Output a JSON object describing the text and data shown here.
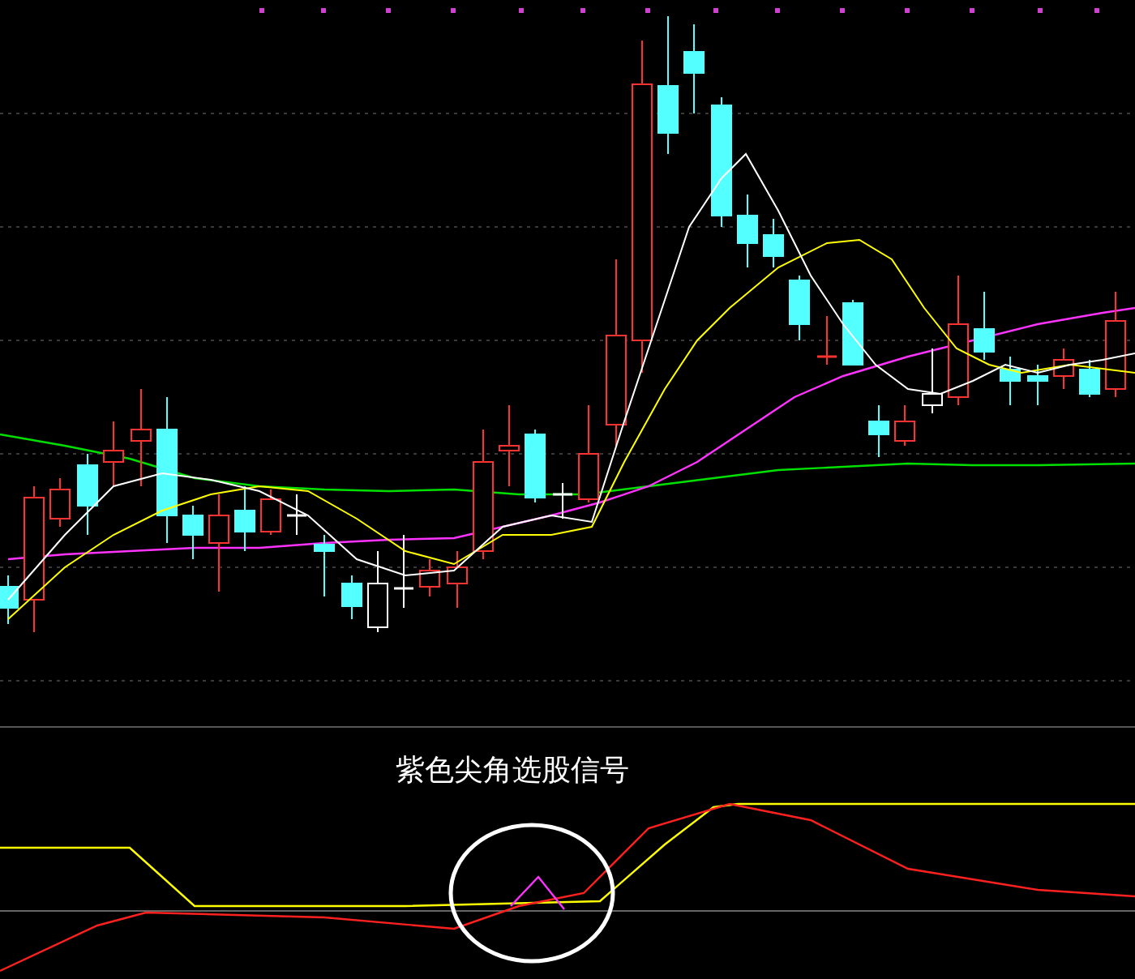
{
  "indicator_panel": {
    "annotation": "紫色尖角选股信号"
  }
}
